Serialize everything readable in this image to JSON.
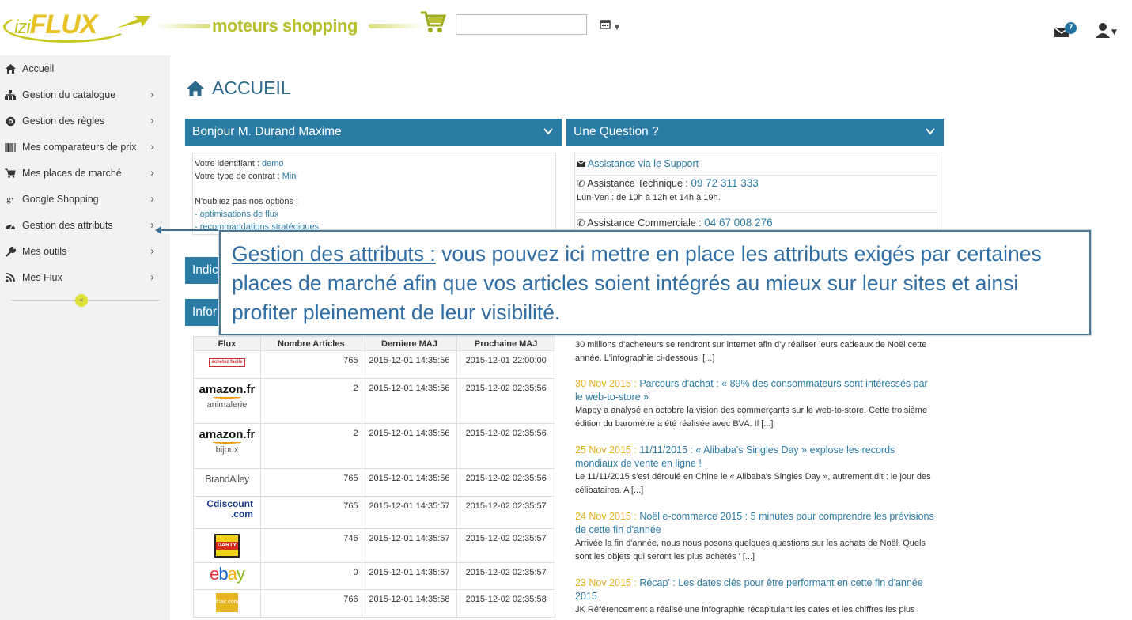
{
  "header": {
    "logo_prefix": "izi",
    "logo_main": "FLUX",
    "tagline": "moteurs shopping",
    "search_value": "",
    "notification_count": "7",
    "icons": [
      "calendar-icon",
      "mail-icon",
      "user-icon",
      "cart-icon"
    ]
  },
  "sidebar": {
    "items": [
      {
        "label": "Accueil",
        "icon": "home-icon",
        "has_chevron": false
      },
      {
        "label": "Gestion du catalogue",
        "icon": "sitemap-icon",
        "has_chevron": true
      },
      {
        "label": "Gestion des règles",
        "icon": "gear-icon",
        "has_chevron": true
      },
      {
        "label": "Mes comparateurs de prix",
        "icon": "barcode-icon",
        "has_chevron": true
      },
      {
        "label": "Mes places de marché",
        "icon": "cart-icon",
        "has_chevron": true
      },
      {
        "label": "Google Shopping",
        "icon": "google-plus-icon",
        "has_chevron": true
      },
      {
        "label": "Gestion des attributs",
        "icon": "dashboard-icon",
        "has_chevron": true
      },
      {
        "label": "Mes outils",
        "icon": "wrench-icon",
        "has_chevron": true
      },
      {
        "label": "Mes Flux",
        "icon": "rss-icon",
        "has_chevron": true
      }
    ]
  },
  "main": {
    "title": "ACCUEIL",
    "welcome_panel": {
      "title": "Bonjour M. Durand Maxime",
      "identifiant_label": "Votre identifiant : ",
      "identifiant_value": "demo",
      "contrat_label": "Votre type de contrat : ",
      "contrat_value": "Mini",
      "options_label": "N'oubliez pas nos options :",
      "option1": "- optimisations de flux",
      "option2": "- recommandations stratégiques"
    },
    "question_panel": {
      "title": "Une Question ?",
      "support_link": "Assistance via le Support",
      "tech_label": "Assistance Technique : ",
      "tech_phone": "09 72 311 333",
      "tech_hours": "Lun-Ven : de 10h à 12h et 14h à 19h.",
      "commercial_label": "Assistance Commerciale : ",
      "commercial_phone": "04 67 008 276"
    },
    "indic_panel_title": "Indic",
    "info_panel_title": "Infor",
    "flux_table": {
      "headers": [
        "Flux",
        "Nombre Articles",
        "Derniere MAJ",
        "Prochaine MAJ"
      ],
      "rows": [
        {
          "flux": "achetez facile",
          "logo": "achetez-facile-logo",
          "sub": "",
          "count": "765",
          "last": "2015-12-01 14:35:56",
          "next": "2015-12-01 22:00:00"
        },
        {
          "flux": "amazon.fr",
          "logo": "amazon-logo",
          "sub": "animalerie",
          "count": "2",
          "last": "2015-12-01 14:35:56",
          "next": "2015-12-02 02:35:56"
        },
        {
          "flux": "amazon.fr",
          "logo": "amazon-logo",
          "sub": "bijoux",
          "count": "2",
          "last": "2015-12-01 14:35:56",
          "next": "2015-12-02 02:35:56"
        },
        {
          "flux": "BrandAlley",
          "logo": "brandalley-logo",
          "sub": "",
          "count": "765",
          "last": "2015-12-01 14:35:56",
          "next": "2015-12-02 02:35:56"
        },
        {
          "flux": "Cdiscount .com",
          "logo": "cdiscount-logo",
          "sub": "",
          "count": "765",
          "last": "2015-12-01 14:35:57",
          "next": "2015-12-02 02:35:57"
        },
        {
          "flux": "DARTY",
          "logo": "darty-logo",
          "sub": "",
          "count": "746",
          "last": "2015-12-01 14:35:57",
          "next": "2015-12-02 02:35:57"
        },
        {
          "flux": "ebay",
          "logo": "ebay-logo",
          "sub": "",
          "count": "0",
          "last": "2015-12-01 14:35:57",
          "next": "2015-12-02 02:35:57"
        },
        {
          "flux": "fnac.com",
          "logo": "fnac-logo",
          "sub": "",
          "count": "766",
          "last": "2015-12-01 14:35:58",
          "next": "2015-12-02 02:35:58"
        }
      ]
    },
    "news": [
      {
        "date": "",
        "title": "",
        "text": "30 millions d'acheteurs se rendront sur internet afin d'y réaliser leurs cadeaux de Noël cette année. L'infographie ci-dessous. [...]"
      },
      {
        "date": "30 Nov 2015 : ",
        "title": "Parcours d'achat : « 89% des consommateurs sont intéressés par le web-to-store »",
        "text": "Mappy a analysé en octobre la vision des commerçants sur le web-to-store. Cette troisième édition du baromètre a été réalisée avec BVA. Il [...]"
      },
      {
        "date": "25 Nov 2015 : ",
        "title": "11/11/2015 : « Alibaba's Singles Day » explose les records mondiaux de vente en ligne !",
        "text": "Le 11/11/2015 s'est déroulé en Chine le « Alibaba's Singles Day », autrement dit : le jour des célibataires. A [...]"
      },
      {
        "date": "24 Nov 2015 : ",
        "title": "Noël e-commerce 2015 : 5 minutes pour comprendre les prévisions de cette fin d'année",
        "text": "Arrivée la fin d'année, nous nous posons quelques questions sur les achats de Noël. Quels sont les objets qui seront les plus achetés ' [...]"
      },
      {
        "date": "23 Nov 2015 : ",
        "title": "Récap' : Les dates clés pour être performant en cette fin d'année 2015",
        "text": "JK Référencement a réalisé une infographie récapitulant les dates et les chiffres les plus"
      }
    ]
  },
  "callout": {
    "title": "Gestion des attributs :",
    "text": " vous pouvez ici mettre en place les attributs exigés par certaines places de marché afin que vos articles soient intégrés au mieux sur leur sites et ainsi profiter pleinement de leur visibilité."
  },
  "colors": {
    "accent": "#2a7ba6",
    "brand_yellow": "#c8c820",
    "news_date": "#e5b01c",
    "callout_text": "#2f6da2"
  }
}
